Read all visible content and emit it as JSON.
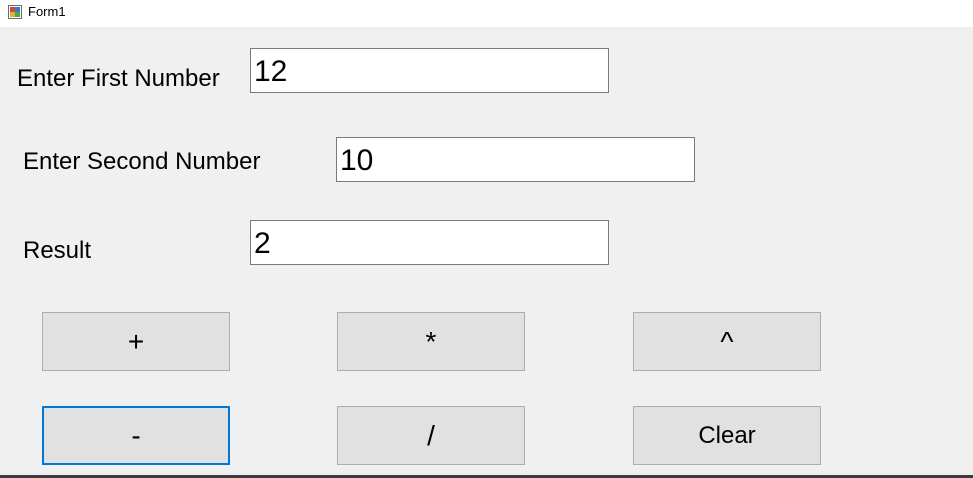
{
  "window": {
    "title": "Form1",
    "icon": "winforms-app-icon"
  },
  "form": {
    "first_label": "Enter First Number",
    "first_value": "12",
    "second_label": "Enter Second Number",
    "second_value": "10",
    "result_label": "Result",
    "result_value": "2"
  },
  "buttons": {
    "add": "+",
    "multiply": "*",
    "power": "^",
    "subtract": "-",
    "divide": "/",
    "clear": "Clear"
  },
  "colors": {
    "form_background": "#f0f0f0",
    "button_face": "#e1e1e1",
    "focus_border": "#0078d7"
  }
}
